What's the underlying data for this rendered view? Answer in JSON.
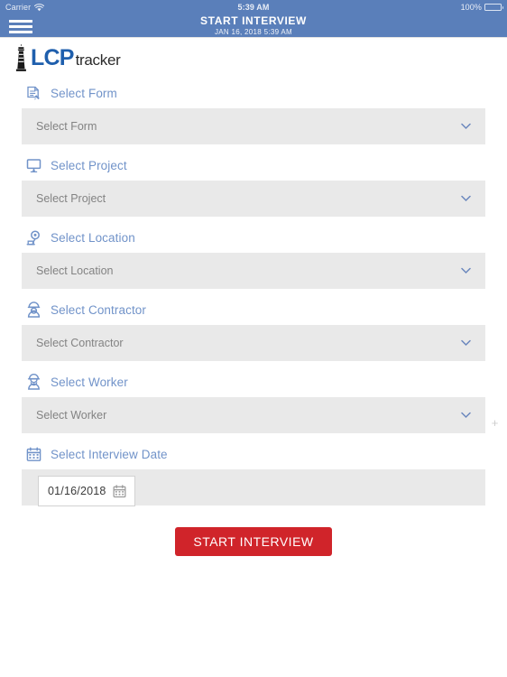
{
  "status_bar": {
    "carrier": "Carrier",
    "wifi_icon": "wifi-icon",
    "time": "5:39 AM",
    "battery_percent": "100%",
    "battery_icon": "battery-full-icon"
  },
  "nav_bar": {
    "menu_icon": "hamburger-menu-icon",
    "title": "START INTERVIEW",
    "subtitle": "JAN 16, 2018 5:39 AM"
  },
  "logo": {
    "icon": "lighthouse-icon",
    "primary": "LCP",
    "secondary": "tracker"
  },
  "form": {
    "fields": [
      {
        "label": "Select Form",
        "icon": "document-pencil-icon",
        "placeholder": "Select Form",
        "chevron": "chevron-down-icon"
      },
      {
        "label": "Select Project",
        "icon": "projector-screen-icon",
        "placeholder": "Select Project",
        "chevron": "chevron-down-icon"
      },
      {
        "label": "Select Location",
        "icon": "map-pin-icon",
        "placeholder": "Select Location",
        "chevron": "chevron-down-icon"
      },
      {
        "label": "Select Contractor",
        "icon": "contractor-worker-icon",
        "placeholder": "Select Contractor",
        "chevron": "chevron-down-icon"
      },
      {
        "label": "Select Worker",
        "icon": "worker-hardhat-icon",
        "placeholder": "Select Worker",
        "chevron": "chevron-down-icon"
      }
    ],
    "date_field": {
      "label": "Select Interview Date",
      "icon": "calendar-icon",
      "value": "01/16/2018",
      "picker_icon": "calendar-picker-icon"
    },
    "submit_label": "START INTERVIEW"
  },
  "colors": {
    "header_blue": "#5a7fba",
    "label_blue": "#7193c9",
    "logo_blue": "#1f5fad",
    "button_red": "#d0242a",
    "field_gray": "#e9e9e9"
  },
  "misc": {
    "plus_marker": "+"
  }
}
